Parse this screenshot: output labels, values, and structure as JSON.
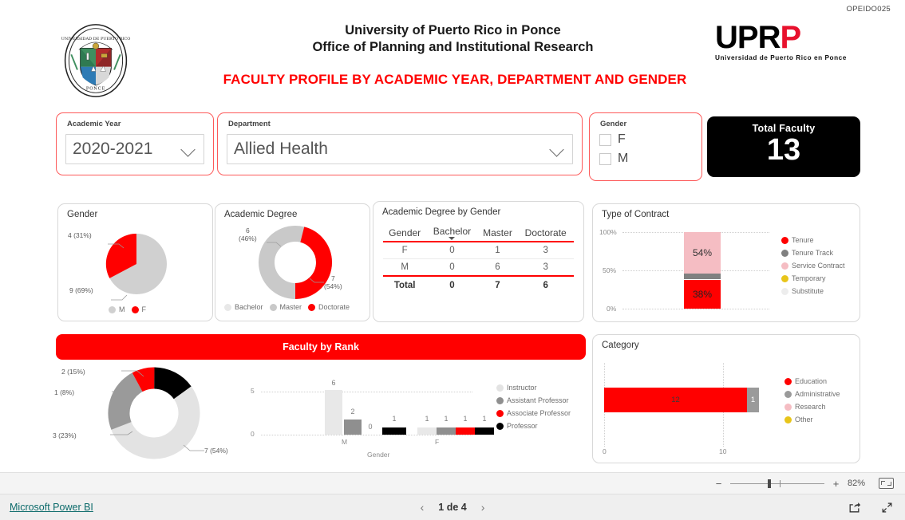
{
  "header": {
    "doc_code": "OPEIDO025",
    "institution_line1": "University of Puerto Rico in Ponce",
    "institution_line2": "Office of Planning and Institutional Research",
    "main_title": "FACULTY PROFILE BY ACADEMIC YEAR, DEPARTMENT AND GENDER",
    "logo_black": "UPR",
    "logo_red": "P",
    "logo_subtitle": "Universidad de Puerto Rico en Ponce",
    "seal_icon": "university-seal-icon"
  },
  "filters": {
    "academic_year": {
      "label": "Academic Year",
      "value": "2020-2021",
      "chevron_icon": "chevron-down-icon"
    },
    "department": {
      "label": "Department",
      "value": "Allied Health",
      "chevron_icon": "chevron-down-icon"
    },
    "gender": {
      "label": "Gender",
      "options": [
        {
          "label": "F",
          "checked": false
        },
        {
          "label": "M",
          "checked": false
        }
      ]
    }
  },
  "kpi": {
    "title": "Total Faculty",
    "value": "13"
  },
  "panels": {
    "gender": "Gender",
    "academic_degree": "Academic Degree",
    "degree_by_gender": "Academic Degree by Gender",
    "type_of_contract": "Type of Contract",
    "faculty_by_rank": "Faculty by Rank",
    "category": "Category"
  },
  "chart_data": [
    {
      "id": "gender_pie",
      "type": "pie",
      "title": "Gender",
      "categories": [
        "M",
        "F"
      ],
      "values": [
        9,
        4
      ],
      "labels": [
        "9 (69%)",
        "4 (31%)"
      ],
      "percent": [
        69,
        31
      ],
      "colors": [
        "#d0d0d0",
        "#ff0000"
      ],
      "legend": [
        "M",
        "F"
      ],
      "legend_position": "bottom"
    },
    {
      "id": "academic_degree_donut",
      "type": "pie",
      "title": "Academic Degree",
      "categories": [
        "Bachelor",
        "Master",
        "Doctorate"
      ],
      "values": [
        0,
        7,
        6
      ],
      "labels": [
        "",
        "7\n(54%)",
        "6\n(46%)"
      ],
      "label_master": "7",
      "label_master_pct": "(54%)",
      "label_doctorate": "6",
      "label_doctorate_pct": "(46%)",
      "percent": [
        0,
        54,
        46
      ],
      "colors": [
        "#e8e8e8",
        "#c9c9c9",
        "#ff0000"
      ],
      "legend": [
        "Bachelor",
        "Master",
        "Doctorate"
      ],
      "legend_position": "bottom"
    },
    {
      "id": "degree_by_gender_table",
      "type": "table",
      "title": "Academic Degree by Gender",
      "columns": [
        "Gender",
        "Bachelor",
        "Master",
        "Doctorate"
      ],
      "rows": [
        [
          "F",
          "0",
          "1",
          "3"
        ],
        [
          "M",
          "0",
          "6",
          "3"
        ]
      ],
      "total_row": [
        "Total",
        "0",
        "7",
        "6"
      ],
      "sorted_column": "Bachelor"
    },
    {
      "id": "type_of_contract",
      "type": "bar",
      "subtype": "stacked-100",
      "title": "Type of Contract",
      "categories": [
        ""
      ],
      "series": [
        {
          "name": "Tenure",
          "values": [
            38
          ],
          "label": "38%",
          "color": "#ff0000"
        },
        {
          "name": "Tenure Track",
          "values": [
            8
          ],
          "label": "",
          "color": "#808080"
        },
        {
          "name": "Service Contract",
          "values": [
            54
          ],
          "label": "54%",
          "color": "#f5bdc3"
        },
        {
          "name": "Temporary",
          "values": [
            0
          ],
          "label": "",
          "color": "#e8c51a"
        },
        {
          "name": "Substitute",
          "values": [
            0
          ],
          "label": "",
          "color": "#ededed"
        }
      ],
      "ylim": [
        0,
        100
      ],
      "yticks": [
        "0%",
        "50%",
        "100%"
      ],
      "legend_position": "right",
      "grid": true
    },
    {
      "id": "faculty_by_rank_donut",
      "type": "pie",
      "title": "Faculty by Rank",
      "categories": [
        "Instructor",
        "Assistant Professor",
        "Associate Professor",
        "Professor"
      ],
      "values": [
        7,
        3,
        1,
        2
      ],
      "labels": [
        "7 (54%)",
        "3 (23%)",
        "1 (8%)",
        "2 (15%)"
      ],
      "percent": [
        54,
        23,
        8,
        15
      ],
      "colors": [
        "#e3e3e3",
        "#9a9a9a",
        "#ff0000",
        "#000000"
      ]
    },
    {
      "id": "faculty_by_rank_columns",
      "type": "bar",
      "subtype": "grouped",
      "title": "Faculty by Rank",
      "xlabel": "Gender",
      "categories": [
        "M",
        "F"
      ],
      "series": [
        {
          "name": "Instructor",
          "values": [
            6,
            1
          ],
          "color": "#e8e8e8"
        },
        {
          "name": "Assistant Professor",
          "values": [
            2,
            1
          ],
          "color": "#8f8f8f"
        },
        {
          "name": "Associate Professor",
          "values": [
            0,
            1
          ],
          "color": "#ff0000"
        },
        {
          "name": "Professor",
          "values": [
            1,
            1
          ],
          "color": "#000000"
        }
      ],
      "ylim": [
        0,
        6
      ],
      "yticks": [
        "0",
        "5"
      ],
      "legend_position": "right",
      "grid": true
    },
    {
      "id": "category_bar",
      "type": "bar",
      "subtype": "stacked-horizontal",
      "title": "Category",
      "categories": [
        ""
      ],
      "series": [
        {
          "name": "Education",
          "values": [
            12
          ],
          "label": "12",
          "color": "#ff0000"
        },
        {
          "name": "Administrative",
          "values": [
            1
          ],
          "label": "1",
          "color": "#9a9a9a"
        },
        {
          "name": "Research",
          "values": [
            0
          ],
          "label": "",
          "color": "#f5bdc3"
        },
        {
          "name": "Other",
          "values": [
            0
          ],
          "label": "",
          "color": "#e8c51a"
        }
      ],
      "xlim": [
        0,
        13
      ],
      "xticks": [
        "0",
        "10"
      ],
      "legend_position": "right",
      "grid": true
    }
  ],
  "zoombar": {
    "minus": "−",
    "plus": "+",
    "percent": "82%",
    "fit_icon": "fit-to-page-icon"
  },
  "statusbar": {
    "brand_link": "Microsoft Power BI",
    "prev_icon": "chevron-left-icon",
    "page_text": "1 de 4",
    "next_icon": "chevron-right-icon",
    "share_icon": "share-icon",
    "fullscreen_icon": "fullscreen-icon"
  }
}
